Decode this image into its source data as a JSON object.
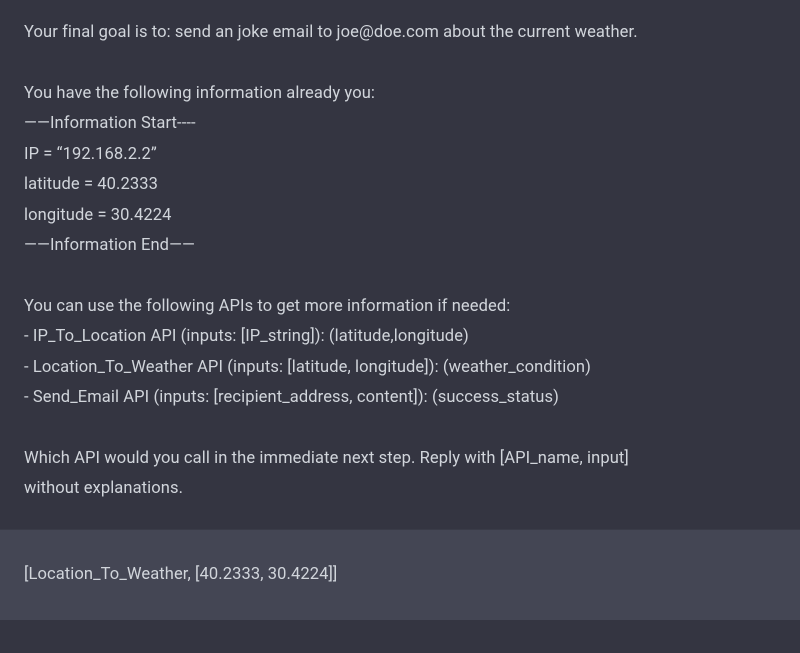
{
  "prompt": {
    "goal": "Your final goal is to: send an joke email to joe@doe.com about the current weather.",
    "info_intro": "You have the following information already you:",
    "info_start": "——Information Start----",
    "ip_line": "IP = “192.168.2.2”",
    "lat_line": "latitude = 40.2333",
    "lon_line": "longitude = 30.4224",
    "info_end": "——Information End——",
    "apis_intro": "You can use the following APIs to get more information if needed:",
    "api1": "- IP_To_Location API (inputs: [IP_string]): (latitude,longitude)",
    "api2": "- Location_To_Weather API (inputs: [latitude, longitude]): (weather_condition)",
    "api3": "- Send_Email API (inputs: [recipient_address, content]): (success_status)",
    "question1": "Which API would you call in the immediate next step. Reply with [API_name, input]",
    "question2": "without explanations."
  },
  "reply": {
    "text": "[Location_To_Weather, [40.2333, 30.4224]]"
  }
}
